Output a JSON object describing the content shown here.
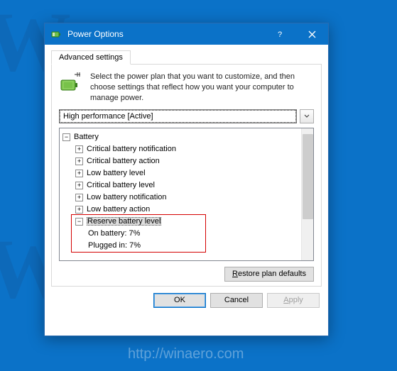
{
  "watermark": {
    "letter": "W",
    "url": "http://winaero.com",
    "footer": "http://winaero.com"
  },
  "window": {
    "title": "Power Options",
    "tab": "Advanced settings",
    "intro": "Select the power plan that you want to customize, and then choose settings that reflect how you want your computer to manage power.",
    "plan": "High performance [Active]",
    "tree": {
      "root": "Battery",
      "items": [
        "Critical battery notification",
        "Critical battery action",
        "Low battery level",
        "Critical battery level",
        "Low battery notification",
        "Low battery action"
      ],
      "reserve": {
        "label": "Reserve battery level",
        "on_battery_label": "On battery:",
        "on_battery_value": "7%",
        "plugged_label": "Plugged in:",
        "plugged_value": "7%"
      }
    },
    "restore_prefix": "R",
    "restore_rest": "estore plan defaults",
    "buttons": {
      "ok": "OK",
      "cancel": "Cancel",
      "apply_prefix": "A",
      "apply_rest": "pply"
    }
  }
}
